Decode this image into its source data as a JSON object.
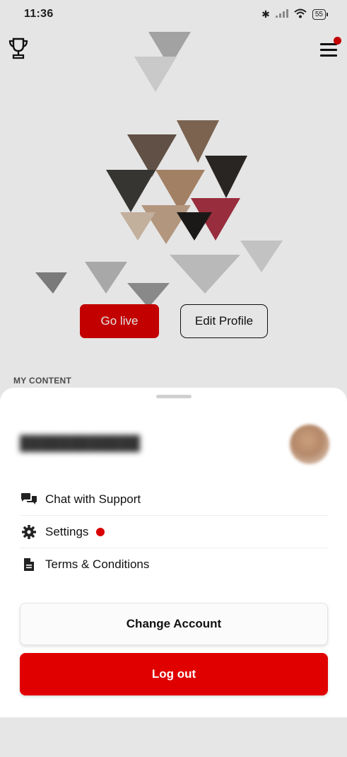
{
  "status_bar": {
    "time": "11:36",
    "battery": "55",
    "icons": [
      "bluetooth-icon",
      "signal-icon",
      "wifi-icon",
      "battery-icon"
    ]
  },
  "top_bar": {
    "left_icon": "trophy-icon",
    "right_icon": "hamburger-menu-icon",
    "has_notification": true
  },
  "profile": {
    "go_live_label": "Go live",
    "edit_profile_label": "Edit Profile",
    "section_label": "MY CONTENT"
  },
  "sheet": {
    "menu": [
      {
        "label": "Chat with Support",
        "icon": "chat-bubbles-icon"
      },
      {
        "label": "Settings",
        "icon": "gear-icon",
        "has_notification": true
      },
      {
        "label": "Terms & Conditions",
        "icon": "document-icon"
      }
    ],
    "change_account_label": "Change Account",
    "logout_label": "Log out"
  },
  "colors": {
    "accent": "#e00000",
    "notification": "#d80000"
  }
}
